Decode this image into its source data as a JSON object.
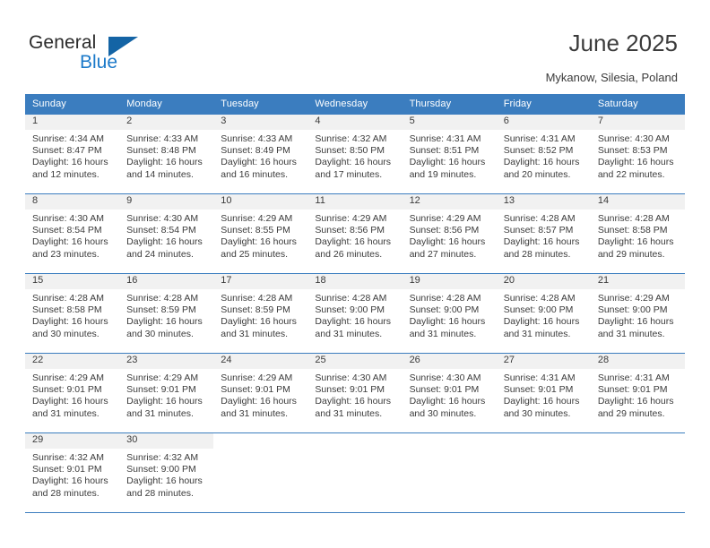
{
  "brand": {
    "name_top": "General",
    "name_bottom": "Blue",
    "triangle_color": "#1464a5",
    "blue_color": "#1b79c9"
  },
  "header": {
    "title": "June 2025",
    "subtitle": "Mykanow, Silesia, Poland"
  },
  "theme": {
    "header_bg": "#3b7dbf",
    "header_text": "#ffffff",
    "daynum_strip_bg": "#f1f1f1",
    "body_text": "#3b3b3b",
    "rule_color": "#3b7dbf"
  },
  "weekday_headers": [
    "Sunday",
    "Monday",
    "Tuesday",
    "Wednesday",
    "Thursday",
    "Friday",
    "Saturday"
  ],
  "labels": {
    "sunrise_prefix": "Sunrise:",
    "sunset_prefix": "Sunset:",
    "daylight_prefix": "Daylight:"
  },
  "weeks": [
    [
      {
        "day": "1",
        "sunrise": "Sunrise: 4:34 AM",
        "sunset": "Sunset: 8:47 PM",
        "daylight_1": "Daylight: 16 hours",
        "daylight_2": "and 12 minutes."
      },
      {
        "day": "2",
        "sunrise": "Sunrise: 4:33 AM",
        "sunset": "Sunset: 8:48 PM",
        "daylight_1": "Daylight: 16 hours",
        "daylight_2": "and 14 minutes."
      },
      {
        "day": "3",
        "sunrise": "Sunrise: 4:33 AM",
        "sunset": "Sunset: 8:49 PM",
        "daylight_1": "Daylight: 16 hours",
        "daylight_2": "and 16 minutes."
      },
      {
        "day": "4",
        "sunrise": "Sunrise: 4:32 AM",
        "sunset": "Sunset: 8:50 PM",
        "daylight_1": "Daylight: 16 hours",
        "daylight_2": "and 17 minutes."
      },
      {
        "day": "5",
        "sunrise": "Sunrise: 4:31 AM",
        "sunset": "Sunset: 8:51 PM",
        "daylight_1": "Daylight: 16 hours",
        "daylight_2": "and 19 minutes."
      },
      {
        "day": "6",
        "sunrise": "Sunrise: 4:31 AM",
        "sunset": "Sunset: 8:52 PM",
        "daylight_1": "Daylight: 16 hours",
        "daylight_2": "and 20 minutes."
      },
      {
        "day": "7",
        "sunrise": "Sunrise: 4:30 AM",
        "sunset": "Sunset: 8:53 PM",
        "daylight_1": "Daylight: 16 hours",
        "daylight_2": "and 22 minutes."
      }
    ],
    [
      {
        "day": "8",
        "sunrise": "Sunrise: 4:30 AM",
        "sunset": "Sunset: 8:54 PM",
        "daylight_1": "Daylight: 16 hours",
        "daylight_2": "and 23 minutes."
      },
      {
        "day": "9",
        "sunrise": "Sunrise: 4:30 AM",
        "sunset": "Sunset: 8:54 PM",
        "daylight_1": "Daylight: 16 hours",
        "daylight_2": "and 24 minutes."
      },
      {
        "day": "10",
        "sunrise": "Sunrise: 4:29 AM",
        "sunset": "Sunset: 8:55 PM",
        "daylight_1": "Daylight: 16 hours",
        "daylight_2": "and 25 minutes."
      },
      {
        "day": "11",
        "sunrise": "Sunrise: 4:29 AM",
        "sunset": "Sunset: 8:56 PM",
        "daylight_1": "Daylight: 16 hours",
        "daylight_2": "and 26 minutes."
      },
      {
        "day": "12",
        "sunrise": "Sunrise: 4:29 AM",
        "sunset": "Sunset: 8:56 PM",
        "daylight_1": "Daylight: 16 hours",
        "daylight_2": "and 27 minutes."
      },
      {
        "day": "13",
        "sunrise": "Sunrise: 4:28 AM",
        "sunset": "Sunset: 8:57 PM",
        "daylight_1": "Daylight: 16 hours",
        "daylight_2": "and 28 minutes."
      },
      {
        "day": "14",
        "sunrise": "Sunrise: 4:28 AM",
        "sunset": "Sunset: 8:58 PM",
        "daylight_1": "Daylight: 16 hours",
        "daylight_2": "and 29 minutes."
      }
    ],
    [
      {
        "day": "15",
        "sunrise": "Sunrise: 4:28 AM",
        "sunset": "Sunset: 8:58 PM",
        "daylight_1": "Daylight: 16 hours",
        "daylight_2": "and 30 minutes."
      },
      {
        "day": "16",
        "sunrise": "Sunrise: 4:28 AM",
        "sunset": "Sunset: 8:59 PM",
        "daylight_1": "Daylight: 16 hours",
        "daylight_2": "and 30 minutes."
      },
      {
        "day": "17",
        "sunrise": "Sunrise: 4:28 AM",
        "sunset": "Sunset: 8:59 PM",
        "daylight_1": "Daylight: 16 hours",
        "daylight_2": "and 31 minutes."
      },
      {
        "day": "18",
        "sunrise": "Sunrise: 4:28 AM",
        "sunset": "Sunset: 9:00 PM",
        "daylight_1": "Daylight: 16 hours",
        "daylight_2": "and 31 minutes."
      },
      {
        "day": "19",
        "sunrise": "Sunrise: 4:28 AM",
        "sunset": "Sunset: 9:00 PM",
        "daylight_1": "Daylight: 16 hours",
        "daylight_2": "and 31 minutes."
      },
      {
        "day": "20",
        "sunrise": "Sunrise: 4:28 AM",
        "sunset": "Sunset: 9:00 PM",
        "daylight_1": "Daylight: 16 hours",
        "daylight_2": "and 31 minutes."
      },
      {
        "day": "21",
        "sunrise": "Sunrise: 4:29 AM",
        "sunset": "Sunset: 9:00 PM",
        "daylight_1": "Daylight: 16 hours",
        "daylight_2": "and 31 minutes."
      }
    ],
    [
      {
        "day": "22",
        "sunrise": "Sunrise: 4:29 AM",
        "sunset": "Sunset: 9:01 PM",
        "daylight_1": "Daylight: 16 hours",
        "daylight_2": "and 31 minutes."
      },
      {
        "day": "23",
        "sunrise": "Sunrise: 4:29 AM",
        "sunset": "Sunset: 9:01 PM",
        "daylight_1": "Daylight: 16 hours",
        "daylight_2": "and 31 minutes."
      },
      {
        "day": "24",
        "sunrise": "Sunrise: 4:29 AM",
        "sunset": "Sunset: 9:01 PM",
        "daylight_1": "Daylight: 16 hours",
        "daylight_2": "and 31 minutes."
      },
      {
        "day": "25",
        "sunrise": "Sunrise: 4:30 AM",
        "sunset": "Sunset: 9:01 PM",
        "daylight_1": "Daylight: 16 hours",
        "daylight_2": "and 31 minutes."
      },
      {
        "day": "26",
        "sunrise": "Sunrise: 4:30 AM",
        "sunset": "Sunset: 9:01 PM",
        "daylight_1": "Daylight: 16 hours",
        "daylight_2": "and 30 minutes."
      },
      {
        "day": "27",
        "sunrise": "Sunrise: 4:31 AM",
        "sunset": "Sunset: 9:01 PM",
        "daylight_1": "Daylight: 16 hours",
        "daylight_2": "and 30 minutes."
      },
      {
        "day": "28",
        "sunrise": "Sunrise: 4:31 AM",
        "sunset": "Sunset: 9:01 PM",
        "daylight_1": "Daylight: 16 hours",
        "daylight_2": "and 29 minutes."
      }
    ],
    [
      {
        "day": "29",
        "sunrise": "Sunrise: 4:32 AM",
        "sunset": "Sunset: 9:01 PM",
        "daylight_1": "Daylight: 16 hours",
        "daylight_2": "and 28 minutes."
      },
      {
        "day": "30",
        "sunrise": "Sunrise: 4:32 AM",
        "sunset": "Sunset: 9:00 PM",
        "daylight_1": "Daylight: 16 hours",
        "daylight_2": "and 28 minutes."
      },
      null,
      null,
      null,
      null,
      null
    ]
  ]
}
